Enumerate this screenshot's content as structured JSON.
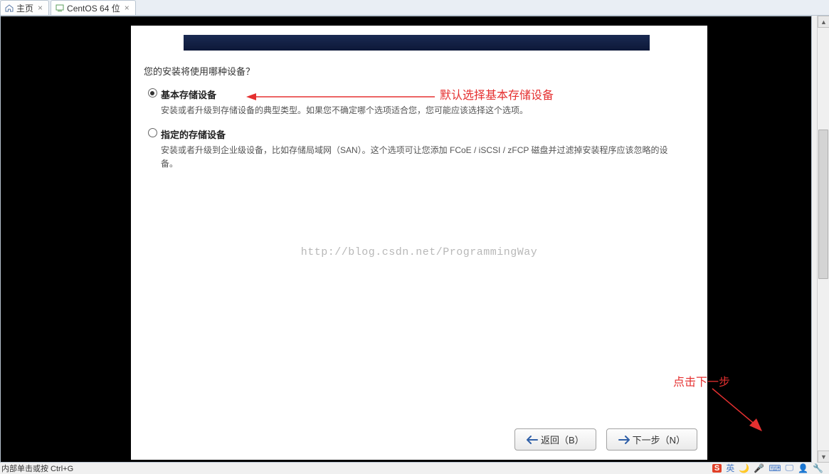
{
  "tabs": [
    {
      "label": "主页",
      "icon": "home"
    },
    {
      "label": "CentOS 64 位",
      "icon": "vm"
    }
  ],
  "installer": {
    "question": "您的安装将使用哪种设备？",
    "options": [
      {
        "title": "基本存储设备",
        "desc": "安装或者升级到存储设备的典型类型。如果您不确定哪个选项适合您，您可能应该选择这个选项。",
        "selected": true
      },
      {
        "title": "指定的存储设备",
        "desc": "安装或者升级到企业级设备，比如存储局域网（SAN）。这个选项可让您添加 FCoE / iSCSI / zFCP 磁盘并过滤掉安装程序应该忽略的设备。",
        "selected": false
      }
    ],
    "watermark": "http://blog.csdn.net/ProgrammingWay",
    "buttons": {
      "back": "返回（B）",
      "next": "下一步（N）"
    }
  },
  "annotations": {
    "a1": "默认选择基本存储设备",
    "a2": "点击下一步"
  },
  "status": {
    "left": "内部单击或按 Ctrl+G",
    "ime": "英"
  },
  "colors": {
    "annotation": "#e53030"
  }
}
